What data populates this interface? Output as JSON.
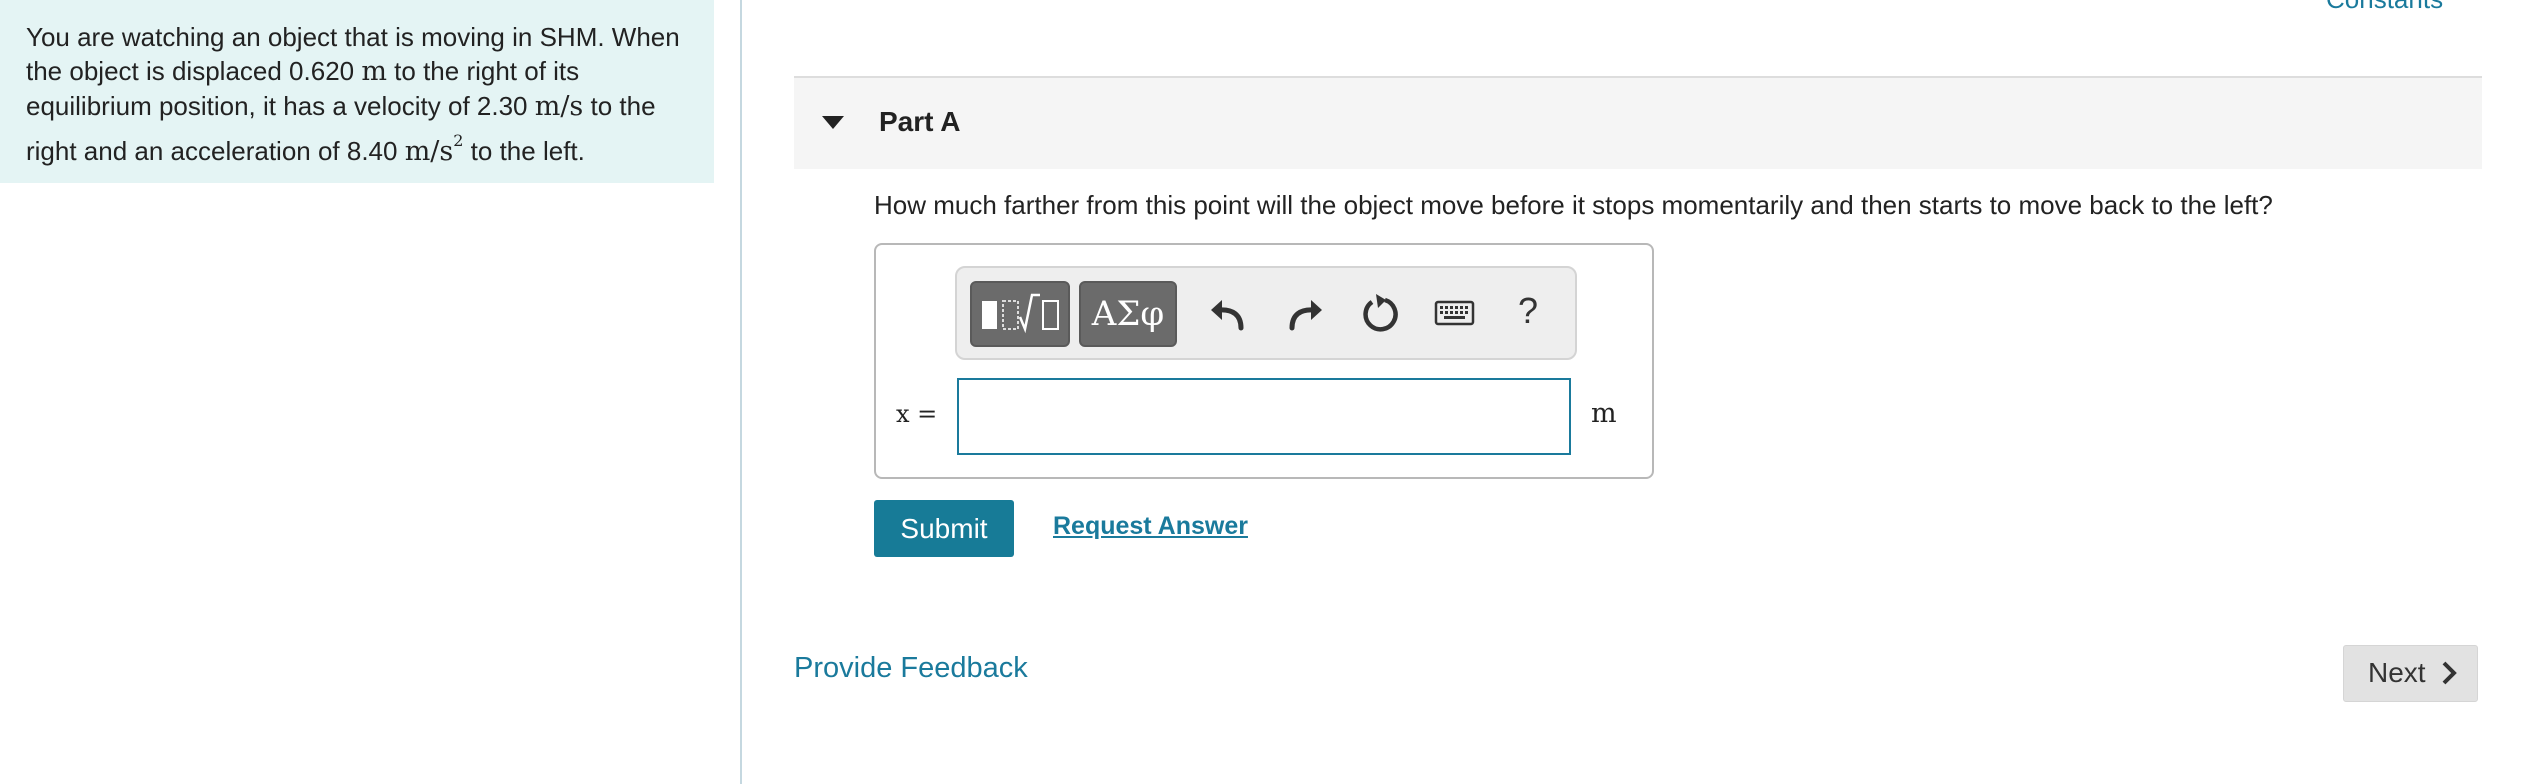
{
  "problem": {
    "seg1": "You are watching an object that is moving in SHM. When the object is displaced 0.620 ",
    "unit1": "m",
    "seg2": " to the right of its equilibrium position, it has a velocity of 2.30 ",
    "unit2": "m/s",
    "seg3": " to the right and an acceleration of 8.40 ",
    "unit3": "m/s",
    "unit3_exp": "2",
    "seg4": "  to the left."
  },
  "header": {
    "constants_link": "Constants"
  },
  "part": {
    "title": "Part A",
    "question": "How much farther from this point will the object move before it stops momentarily and then starts to move back to the left?"
  },
  "toolbar": {
    "templates_icon": "templates-sqrt-icon",
    "greek_label": "ΑΣφ",
    "undo_icon": "undo-icon",
    "redo_icon": "redo-icon",
    "reset_icon": "reset-icon",
    "keyboard_icon": "keyboard-icon",
    "help_label": "?"
  },
  "answer": {
    "variable_label": "x =",
    "value": "",
    "placeholder": "",
    "unit": "m"
  },
  "actions": {
    "submit_label": "Submit",
    "request_answer_label": "Request Answer",
    "feedback_label": "Provide Feedback",
    "next_label": "Next"
  },
  "colors": {
    "accent": "#177b97",
    "panel_bg": "#e4f4f4",
    "toolbar_button": "#6b6b6b"
  }
}
